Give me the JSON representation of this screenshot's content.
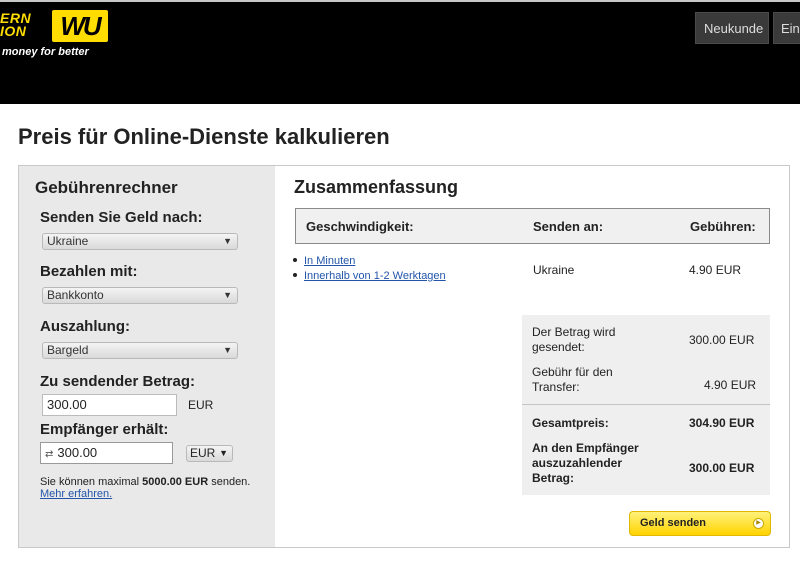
{
  "header": {
    "logo_line1": "ERN",
    "logo_line2": "ION",
    "logo_mark": "WU",
    "tagline": "money for better",
    "nav": {
      "neukunde": "Neukunde",
      "ein": "Ein"
    }
  },
  "page": {
    "title": "Preis für Online-Dienste kalkulieren"
  },
  "calculator": {
    "title": "Gebührenrechner",
    "send_to_label": "Senden Sie Geld nach:",
    "send_to_value": "Ukraine",
    "pay_with_label": "Bezahlen mit:",
    "pay_with_value": "Bankkonto",
    "payout_label": "Auszahlung:",
    "payout_value": "Bargeld",
    "amount_label": "Zu sendender Betrag:",
    "amount_value": "300.00",
    "amount_currency": "EUR",
    "receiver_label": "Empfänger erhält:",
    "receiver_value": "300.00",
    "receiver_currency": "EUR",
    "limit_prefix": "Sie können maximal ",
    "limit_amount": "5000.00 EUR",
    "limit_suffix": " senden.",
    "learn_more": "Mehr erfahren."
  },
  "summary": {
    "title": "Zusammenfassung",
    "col_speed": "Geschwindigkeit:",
    "col_send_to": "Senden an:",
    "col_fees": "Gebühren:",
    "speeds": [
      "In Minuten",
      "Innerhalb von 1-2 Werktagen"
    ],
    "country": "Ukraine",
    "fee": "4.90 EUR",
    "sent_amount_label_1": "Der Betrag wird",
    "sent_amount_label_2": "gesendet:",
    "sent_amount_value": "300.00 EUR",
    "transfer_fee_label_1": "Gebühr für den",
    "transfer_fee_label_2": "Transfer:",
    "transfer_fee_value": "4.90 EUR",
    "total_label": "Gesamtpreis:",
    "total_value": "304.90 EUR",
    "payout_label_1": "An den Empfänger",
    "payout_label_2": "auszuzahlender",
    "payout_label_3": "Betrag:",
    "payout_value": "300.00 EUR",
    "send_button": "Geld senden"
  },
  "colors": {
    "brand_yellow": "#ffdd00",
    "link_blue": "#2255aa"
  }
}
